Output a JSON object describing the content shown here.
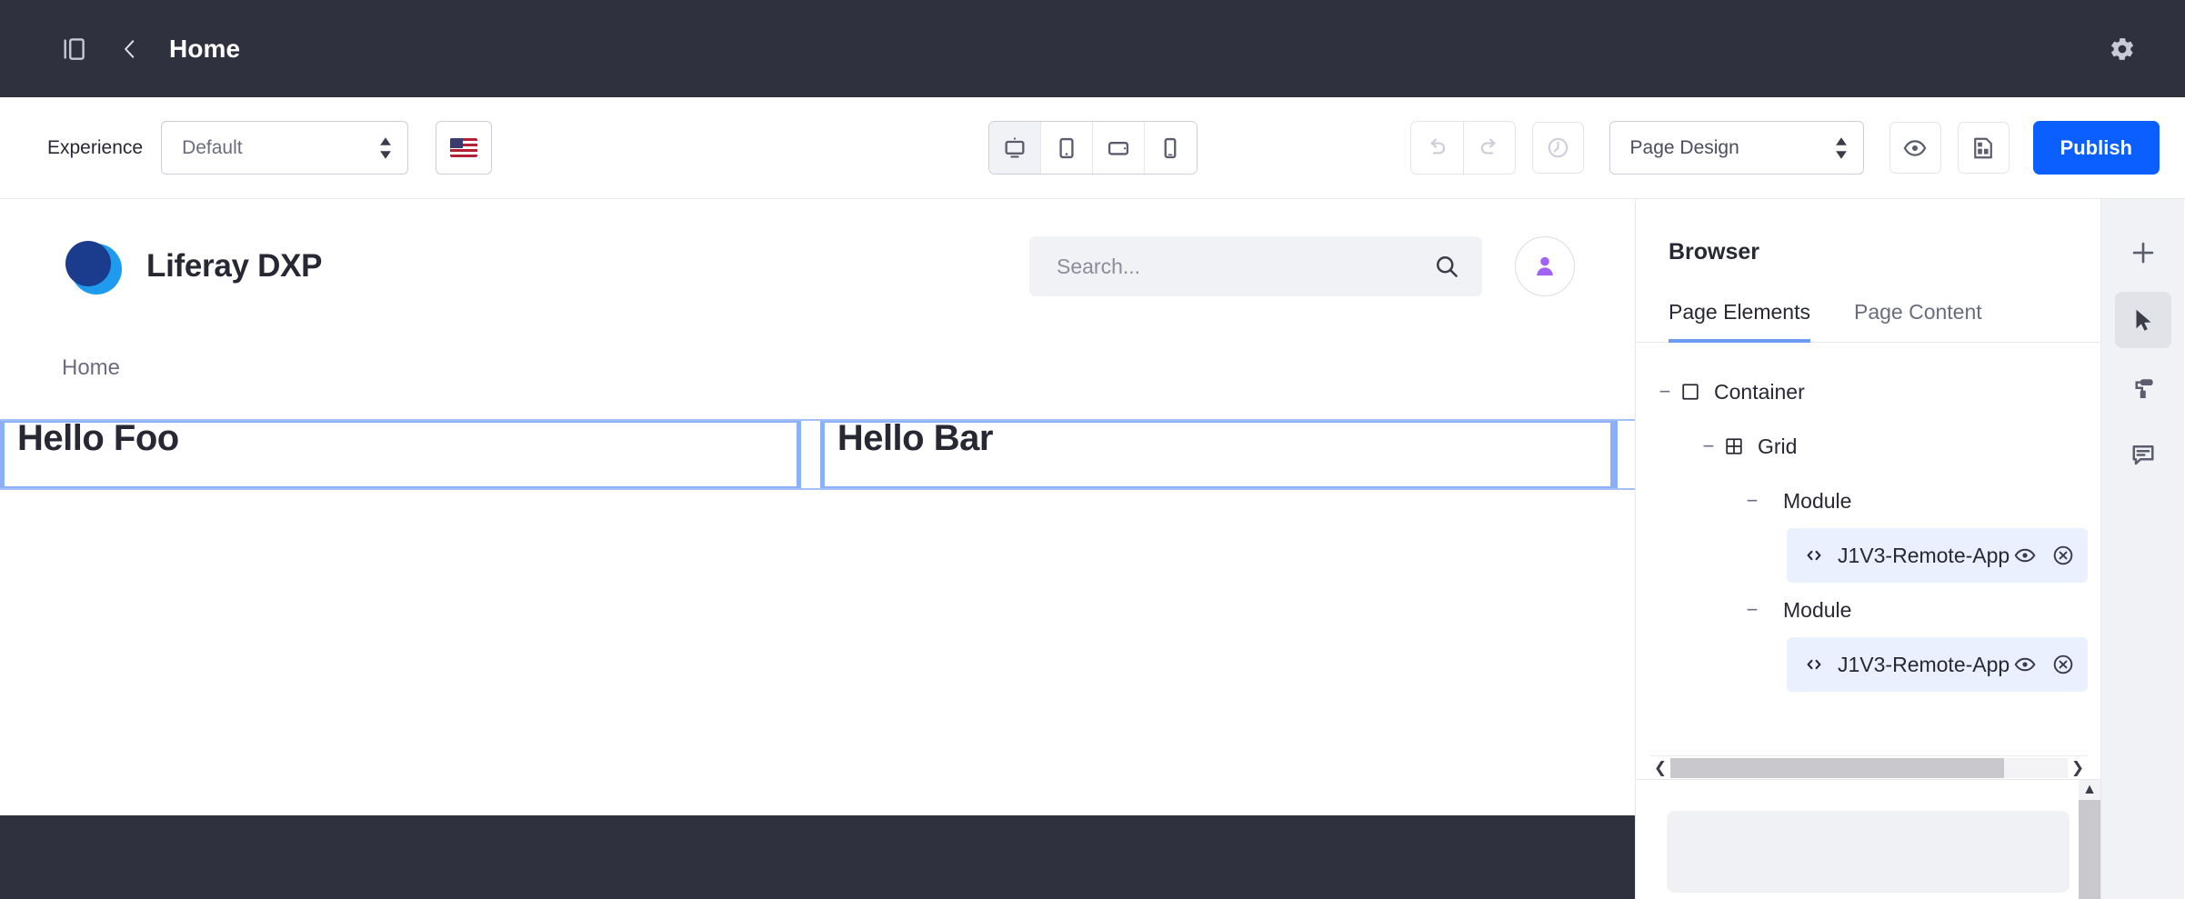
{
  "topbar": {
    "sidebar_toggle_icon": "panel-toggle-icon",
    "back_icon": "chevron-left-icon",
    "title": "Home",
    "settings_icon": "gear-icon"
  },
  "toolbar": {
    "experience_label": "Experience",
    "experience_value": "Default",
    "language_flag": "us-flag-icon",
    "devices": [
      {
        "name": "desktop",
        "icon": "desktop-icon",
        "active": true
      },
      {
        "name": "tablet-portrait",
        "icon": "tablet-portrait-icon",
        "active": false
      },
      {
        "name": "tablet-landscape",
        "icon": "tablet-landscape-icon",
        "active": false
      },
      {
        "name": "mobile",
        "icon": "mobile-icon",
        "active": false
      }
    ],
    "undo_icon": "undo-icon",
    "redo_icon": "redo-icon",
    "history_icon": "history-clock-icon",
    "page_design_value": "Page Design",
    "preview_icon": "eye-icon",
    "page_layout_icon": "page-layout-icon",
    "publish_label": "Publish",
    "accent_color": "#0b5fff"
  },
  "site": {
    "brand": "Liferay DXP",
    "logo_icon": "liferay-logo-icon",
    "search_placeholder": "Search...",
    "search_value": "",
    "search_icon": "search-icon",
    "avatar_icon": "user-avatar-icon",
    "breadcrumb": "Home",
    "fragments": [
      {
        "heading": "Hello Foo"
      },
      {
        "heading": "Hello Bar"
      }
    ],
    "selection_border_color": "#8ab0fa"
  },
  "sidebar": {
    "title": "Browser",
    "tabs": [
      {
        "label": "Page Elements",
        "active": true
      },
      {
        "label": "Page Content",
        "active": false
      }
    ],
    "tree": [
      {
        "label": "Container",
        "icon": "container-square-icon",
        "toggle": "−",
        "depth": 0,
        "selected": false
      },
      {
        "label": "Grid",
        "icon": "grid-icon",
        "toggle": "−",
        "depth": 1,
        "selected": false
      },
      {
        "label": "Module",
        "icon": "",
        "toggle": "−",
        "depth": 2,
        "selected": false
      },
      {
        "label": "J1V3-Remote-App",
        "icon": "code-brackets-icon",
        "toggle": "",
        "depth": 3,
        "selected": true
      },
      {
        "label": "Module",
        "icon": "",
        "toggle": "−",
        "depth": 2,
        "selected": false
      },
      {
        "label": "J1V3-Remote-App",
        "icon": "code-brackets-icon",
        "toggle": "",
        "depth": 3,
        "selected": true
      }
    ],
    "row_action_icons": [
      "eye-icon",
      "remove-circle-icon"
    ],
    "hscroll": {
      "left_icon": "chevron-left-icon",
      "right_icon": "chevron-right-icon"
    },
    "vscroll": {
      "up_icon": "chevron-up-icon"
    }
  },
  "rail": [
    {
      "name": "add",
      "icon": "plus-icon",
      "active": false
    },
    {
      "name": "select",
      "icon": "cursor-pointer-icon",
      "active": true
    },
    {
      "name": "style",
      "icon": "paint-roller-icon",
      "active": false
    },
    {
      "name": "comments",
      "icon": "comment-icon",
      "active": false
    }
  ]
}
